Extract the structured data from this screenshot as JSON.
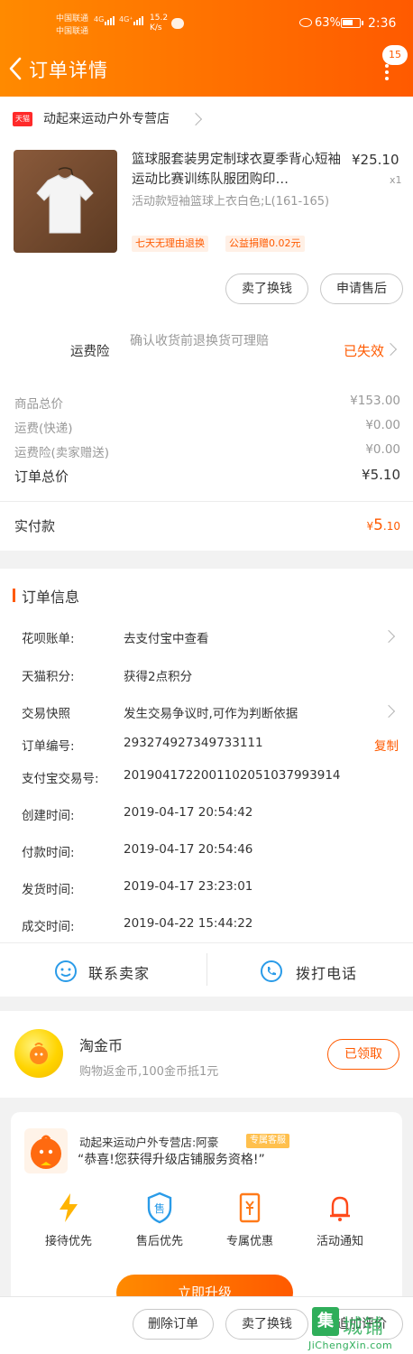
{
  "status_bar": {
    "carrier_1": "中国联通",
    "carrier_2": "中国联通",
    "net_1": "4G",
    "net_2": "4G⁺",
    "speed_value": "15.2",
    "speed_unit": "K/s",
    "battery": "63%",
    "battery_level_percent": 63,
    "time": "2:36"
  },
  "header": {
    "title": "订单详情",
    "notification_count": "15"
  },
  "shop": {
    "platform_tag": "天猫",
    "name": "动起来运动户外专营店"
  },
  "product": {
    "title": "篮球服套装男定制球衣夏季背心短袖运动比赛训练队服团购印…",
    "sku": "活动款短袖篮球上衣白色;L(161-165)",
    "price": "¥25.10",
    "quantity": "x1",
    "tags": [
      "七天无理由退换",
      "公益捐赠0.02元"
    ]
  },
  "item_actions": {
    "sell_label": "卖了换钱",
    "after_sale_label": "申请售后"
  },
  "insurance": {
    "label": "运费险",
    "description": "确认收货前退换货可理赔",
    "status": "已失效"
  },
  "prices": {
    "goods_total_label": "商品总价",
    "goods_total": "¥153.00",
    "shipping_label": "运费(快递)",
    "shipping": "¥0.00",
    "insurance_label": "运费险(卖家赠送)",
    "insurance": "¥0.00",
    "order_total_label": "订单总价",
    "order_total": "¥5.10",
    "paid_label": "实付款",
    "paid_currency": "¥",
    "paid_int": "5",
    "paid_dec": ".10"
  },
  "order_info": {
    "section_title": "订单信息",
    "rows": [
      {
        "key": "花呗账单:",
        "value": "去支付宝中查看"
      },
      {
        "key": "天猫积分:",
        "value": "获得2点积分"
      },
      {
        "key": "交易快照",
        "value": "发生交易争议时,可作为判断依据"
      },
      {
        "key": "订单编号:",
        "value": "293274927349733111"
      },
      {
        "key": "支付宝交易号:",
        "value": "2019041722001102051037993914"
      },
      {
        "key": "创建时间:",
        "value": "2019-04-17 20:54:42"
      },
      {
        "key": "付款时间:",
        "value": "2019-04-17 20:54:46"
      },
      {
        "key": "发货时间:",
        "value": "2019-04-17 23:23:01"
      },
      {
        "key": "成交时间:",
        "value": "2019-04-22 15:44:22"
      }
    ],
    "copy_label": "复制"
  },
  "contact": {
    "seller_label": "联系卖家",
    "call_label": "拨打电话"
  },
  "coins": {
    "title": "淘金币",
    "subtitle": "购物返金币,100金币抵1元",
    "button": "已领取"
  },
  "promo": {
    "shop_line": "动起来运动户外专营店:阿豪",
    "tag": "专属客服",
    "message": "“恭喜!您获得升级店铺服务资格!”",
    "benefits": [
      "接待优先",
      "售后优先",
      "专属优惠",
      "活动通知"
    ],
    "upgrade_button": "立即升级"
  },
  "bottom_bar": {
    "delete_label": "删除订单",
    "sell_label": "卖了换钱",
    "review_label": "追加评价"
  },
  "watermark": {
    "char": "集",
    "text": "城铺",
    "url": "JiChengXin.com"
  },
  "colors": {
    "brand": "#ff5a00",
    "brand_light": "#ff8a00",
    "tmall_red": "#ff2a2a",
    "coin_yellow": "#ffd400",
    "watermark_green": "#2fae5a"
  }
}
